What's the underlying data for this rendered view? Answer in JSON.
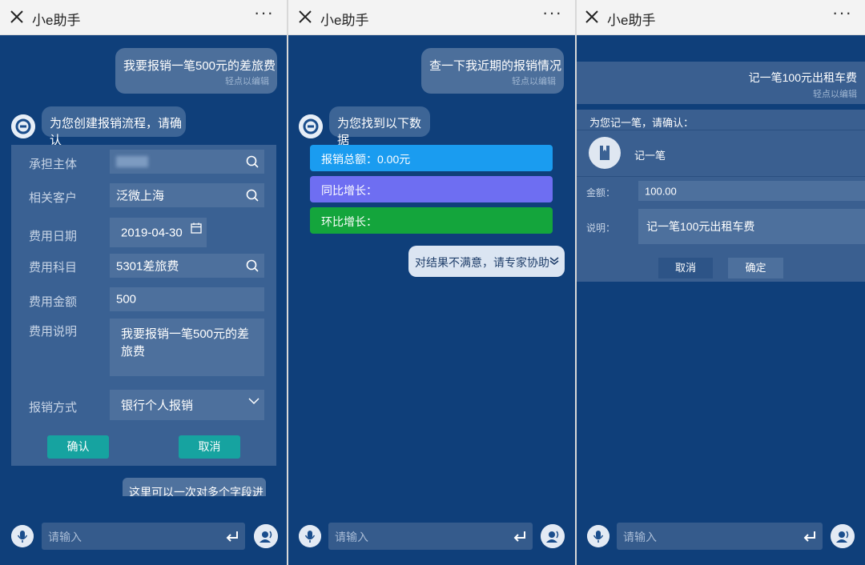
{
  "app_title": "小e助手",
  "more_label": "···",
  "panel1": {
    "user_message": "我要报销一笔500元的差旅费",
    "user_hint": "轻点以编辑",
    "bot_message": "为您创建报销流程，请确认",
    "fields": {
      "entity_label": "承担主体",
      "entity_value": "",
      "customer_label": "相关客户",
      "customer_value": "泛微上海",
      "date_label": "费用日期",
      "date_value": "2019-04-30",
      "subject_label": "费用科目",
      "subject_value": "5301差旅费",
      "amount_label": "费用金额",
      "amount_value": "500",
      "desc_label": "费用说明",
      "desc_value_line1": "我要报销一笔500元的差",
      "desc_value_line2": "旅费",
      "method_label": "报销方式",
      "method_value": "银行个人报销"
    },
    "confirm_label": "确认",
    "cancel_label": "取消",
    "tip_message": "这里可以一次对多个字段进",
    "input_placeholder": "请输入"
  },
  "panel2": {
    "user_message": "查一下我近期的报销情况",
    "user_hint": "轻点以编辑",
    "bot_message": "为您找到以下数据",
    "bars": [
      {
        "label": "报销总额：0.00元",
        "color": "#1a9cf0"
      },
      {
        "label": "同比增长：",
        "color": "#6e6ef2"
      },
      {
        "label": "环比增长：",
        "color": "#14a53c"
      }
    ],
    "expert_message": "对结果不满意，请专家协助",
    "input_placeholder": "请输入"
  },
  "panel3": {
    "user_message": "记一笔100元出租车费",
    "user_hint": "轻点以编辑",
    "bot_message": "为您记一笔，请确认：",
    "record_label": "记一笔",
    "amount_label": "金额：",
    "amount_value": "100.00",
    "desc_label": "说明：",
    "desc_value": "记一笔100元出租车费",
    "cancel_label": "取消",
    "confirm_label": "确定",
    "input_placeholder": "请输入"
  }
}
